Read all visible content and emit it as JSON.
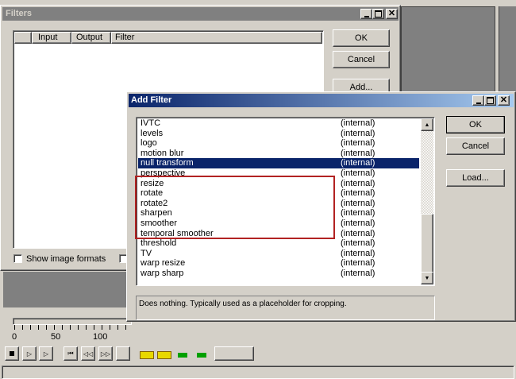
{
  "filters_window": {
    "title": "Filters",
    "columns": [
      "Input",
      "Output",
      "Filter"
    ],
    "buttons": {
      "ok": "OK",
      "cancel": "Cancel",
      "add": "Add..."
    },
    "show_image_formats": "Show image formats"
  },
  "add_filter": {
    "title": "Add Filter",
    "buttons": {
      "ok": "OK",
      "cancel": "Cancel",
      "load": "Load..."
    },
    "filters": [
      {
        "name": "IVTC",
        "source": "(internal)"
      },
      {
        "name": "levels",
        "source": "(internal)"
      },
      {
        "name": "logo",
        "source": "(internal)"
      },
      {
        "name": "motion blur",
        "source": "(internal)"
      },
      {
        "name": "null transform",
        "source": "(internal)",
        "selected": true
      },
      {
        "name": "perspective",
        "source": "(internal)"
      },
      {
        "name": "resize",
        "source": "(internal)"
      },
      {
        "name": "rotate",
        "source": "(internal)"
      },
      {
        "name": "rotate2",
        "source": "(internal)"
      },
      {
        "name": "sharpen",
        "source": "(internal)"
      },
      {
        "name": "smoother",
        "source": "(internal)"
      },
      {
        "name": "temporal smoother",
        "source": "(internal)"
      },
      {
        "name": "threshold",
        "source": "(internal)"
      },
      {
        "name": "TV",
        "source": "(internal)"
      },
      {
        "name": "warp resize",
        "source": "(internal)"
      },
      {
        "name": "warp sharp",
        "source": "(internal)"
      }
    ],
    "description": "Does nothing. Typically used as a placeholder for cropping.",
    "highlight_color": "#b22222"
  },
  "timeline": {
    "ticks": [
      "0",
      "50",
      "100"
    ]
  },
  "colors": {
    "selection": "#0a246a",
    "inactive_title": "#808080",
    "face": "#d4d0c8"
  }
}
